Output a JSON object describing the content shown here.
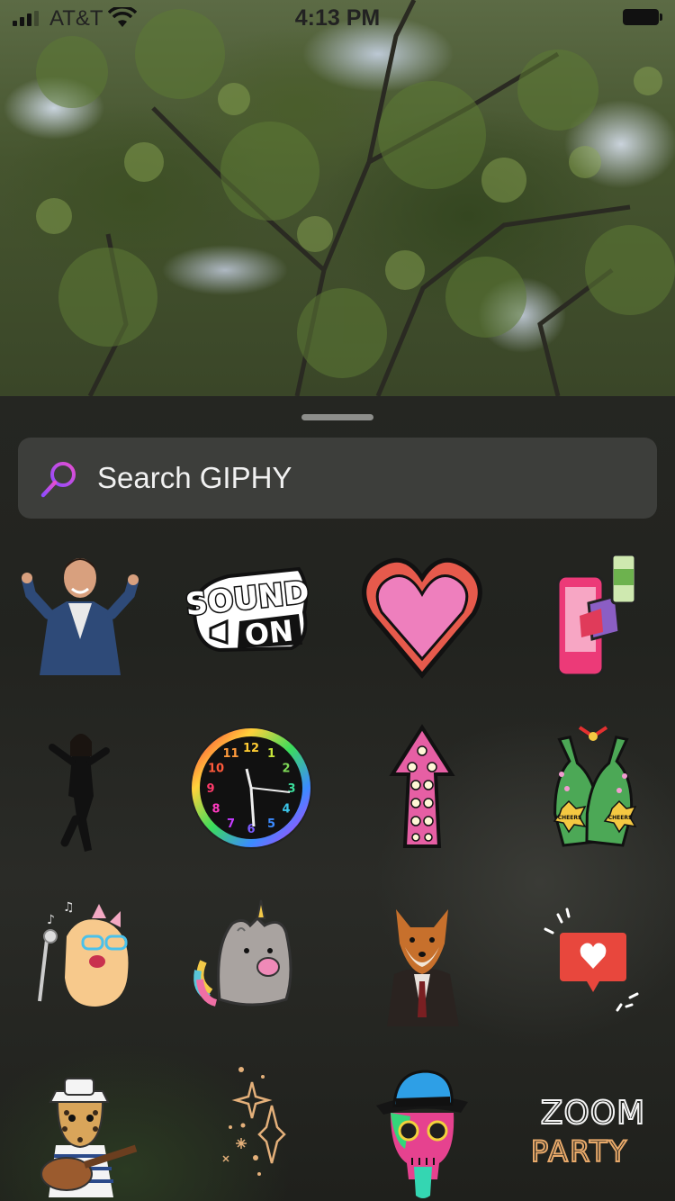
{
  "status_bar": {
    "carrier": "AT&T",
    "time": "4:13 PM"
  },
  "search": {
    "placeholder": "Search GIPHY"
  },
  "stickers": [
    {
      "id": "dancing-man",
      "text": ""
    },
    {
      "id": "sound-on",
      "line1": "SOUND",
      "line2": "ON"
    },
    {
      "id": "heart",
      "text": ""
    },
    {
      "id": "phone-cheers",
      "text": ""
    },
    {
      "id": "dancing-woman",
      "text": ""
    },
    {
      "id": "rainbow-clock",
      "numbers": [
        "12",
        "1",
        "2",
        "3",
        "4",
        "5",
        "6",
        "7",
        "8",
        "9",
        "10",
        "11"
      ]
    },
    {
      "id": "polka-arrow",
      "text": ""
    },
    {
      "id": "cheers-bottles",
      "label1": "CHEERS",
      "label2": "CHEERS"
    },
    {
      "id": "singing-cat",
      "text": ""
    },
    {
      "id": "pusheen-unicorn",
      "text": ""
    },
    {
      "id": "fox-jacket",
      "text": ""
    },
    {
      "id": "like-notification",
      "text": ""
    },
    {
      "id": "leopard-guitar",
      "text": ""
    },
    {
      "id": "sparkles",
      "text": ""
    },
    {
      "id": "neon-skull",
      "text": ""
    },
    {
      "id": "zoom-party",
      "line1": "ZOOM",
      "line2": "PARTY"
    }
  ],
  "colors": {
    "sheet_bg": "#22231f",
    "search_bg": "#3d3e3b",
    "search_icon_gradient": [
      "#b26bff",
      "#e74bd0"
    ],
    "text": "#f1f1f1"
  }
}
